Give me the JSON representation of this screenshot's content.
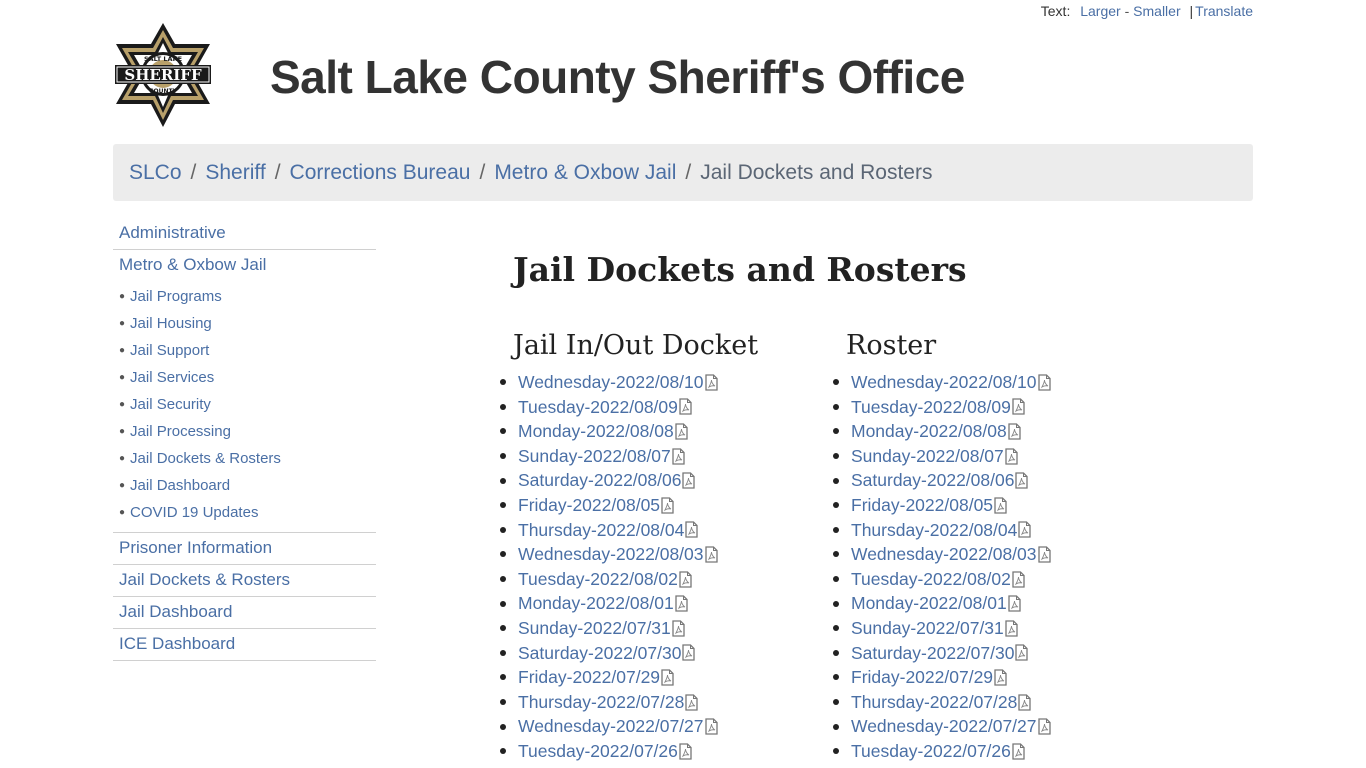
{
  "topbar": {
    "text_label": "Text:",
    "larger": "Larger",
    "dash": "-",
    "smaller": "Smaller",
    "pipe": "|",
    "translate": "Translate"
  },
  "logo": {
    "top_text": "SALT LAKE",
    "main_text": "SHERIFF",
    "bottom_text": "COUNTY",
    "colors": {
      "gold": "#b8a06a",
      "black": "#1a1a1a"
    }
  },
  "header": {
    "title": "Salt Lake County Sheriff's Office"
  },
  "breadcrumb": {
    "items": [
      "SLCo",
      "Sheriff",
      "Corrections Bureau",
      "Metro & Oxbow Jail"
    ],
    "separator": "/",
    "current": "Jail Dockets and Rosters"
  },
  "sidebar": {
    "top_items": [
      "Administrative",
      "Metro & Oxbow Jail"
    ],
    "sub_items": [
      "Jail Programs",
      "Jail Housing",
      "Jail Support",
      "Jail Services",
      "Jail Security",
      "Jail Processing",
      "Jail Dockets & Rosters",
      "Jail Dashboard",
      "COVID 19 Updates"
    ],
    "bottom_items": [
      "Prisoner Information",
      "Jail Dockets & Rosters",
      "Jail Dashboard",
      "ICE Dashboard"
    ]
  },
  "main": {
    "title": "Jail Dockets and Rosters",
    "docket": {
      "heading": "Jail In/Out Docket",
      "items": [
        "Wednesday-2022/08/10",
        "Tuesday-2022/08/09",
        "Monday-2022/08/08",
        "Sunday-2022/08/07",
        "Saturday-2022/08/06",
        "Friday-2022/08/05",
        "Thursday-2022/08/04",
        "Wednesday-2022/08/03",
        "Tuesday-2022/08/02",
        "Monday-2022/08/01",
        "Sunday-2022/07/31",
        "Saturday-2022/07/30",
        "Friday-2022/07/29",
        "Thursday-2022/07/28",
        "Wednesday-2022/07/27",
        "Tuesday-2022/07/26"
      ]
    },
    "roster": {
      "heading": "Roster",
      "items": [
        "Wednesday-2022/08/10",
        "Tuesday-2022/08/09",
        "Monday-2022/08/08",
        "Sunday-2022/08/07",
        "Saturday-2022/08/06",
        "Friday-2022/08/05",
        "Thursday-2022/08/04",
        "Wednesday-2022/08/03",
        "Tuesday-2022/08/02",
        "Monday-2022/08/01",
        "Sunday-2022/07/31",
        "Saturday-2022/07/30",
        "Friday-2022/07/29",
        "Thursday-2022/07/28",
        "Wednesday-2022/07/27",
        "Tuesday-2022/07/26"
      ]
    },
    "item_icon": "pdf-file-icon"
  },
  "colors": {
    "link": "#4a6fa5",
    "breadcrumb_bg": "#ececec",
    "heading": "#222222"
  }
}
